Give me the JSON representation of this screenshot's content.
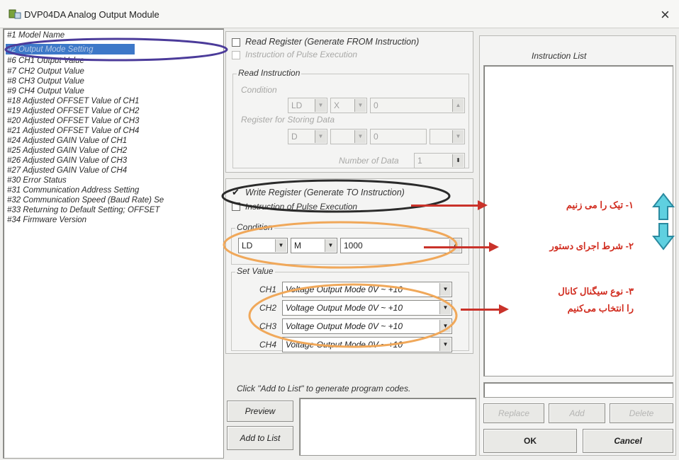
{
  "window": {
    "title": "DVP04DA Analog Output Module",
    "close": "×"
  },
  "left_list": {
    "items": [
      "#1  Model Name",
      "#2  Output Mode Setting",
      "#6  CH1 Output Value",
      "#7  CH2 Output Value",
      "#8  CH3 Output Value",
      "#9  CH4 Output Value",
      "#18 Adjusted OFFSET Value of CH1",
      "#19 Adjusted OFFSET Value of CH2",
      "#20 Adjusted OFFSET Value of CH3",
      "#21 Adjusted OFFSET Value of CH4",
      "#24 Adjusted GAIN Value of CH1",
      "#25 Adjusted GAIN Value of CH2",
      "#26 Adjusted GAIN Value of CH3",
      "#27 Adjusted GAIN Value of CH4",
      "#30 Error Status",
      "#31 Communication Address Setting",
      "#32 Communication Speed (Baud Rate) Se",
      "#33 Returning to Default Setting; OFFSET",
      "#34 Firmware Version"
    ],
    "selected_index": 1
  },
  "read_register": {
    "checkbox_label": "Read Register (Generate FROM Instruction)",
    "pulse_label": "Instruction of Pulse Execution",
    "group_title": "Read Instruction",
    "condition_label": "Condition",
    "cond1": "LD",
    "cond2": "X",
    "cond3": "0",
    "register_label": "Register for Storing Data",
    "reg1": "D",
    "reg2": "",
    "reg3": "0",
    "number_label": "Number of Data",
    "number_value": "1"
  },
  "write_register": {
    "checkbox_label": "Write Register (Generate TO Instruction)",
    "checked_mark": "✔",
    "pulse_label": "Instruction of Pulse Execution",
    "condition_label": "Condition",
    "cond1": "LD",
    "cond2": "M",
    "cond3": "1000",
    "set_value_label": "Set Value",
    "channels": [
      {
        "label": "CH1",
        "value": "Voltage Output Mode 0V ~ +10"
      },
      {
        "label": "CH2",
        "value": "Voltage Output Mode 0V ~ +10"
      },
      {
        "label": "CH3",
        "value": "Voltage Output Mode 0V ~ +10"
      },
      {
        "label": "CH4",
        "value": "Voltage Output Mode 0V ~ +10"
      }
    ]
  },
  "bottom": {
    "hint": "Click \"Add to List\" to generate program codes.",
    "preview_button": "Preview",
    "add_to_list_button": "Add to List"
  },
  "instruction_list": {
    "title": "Instruction List",
    "replace_button": "Replace",
    "add_button": "Add",
    "delete_button": "Delete",
    "ok_button": "OK",
    "cancel_button": "Cancel"
  },
  "annotations": {
    "a1": "۱- تیک را می زنیم",
    "a2": "۲- شرط اجرای دستور",
    "a3_line1": "۳- نوع سیگنال کانال",
    "a3_line2": "را انتخاب می‌کنیم"
  },
  "colors": {
    "selection_blue": "#3d78c8",
    "annotation_red": "#d12c1f",
    "ellipse_purple": "#4b3b9a",
    "ellipse_orange": "#f0a85a",
    "arrow_teal": "#3fb6c9"
  }
}
